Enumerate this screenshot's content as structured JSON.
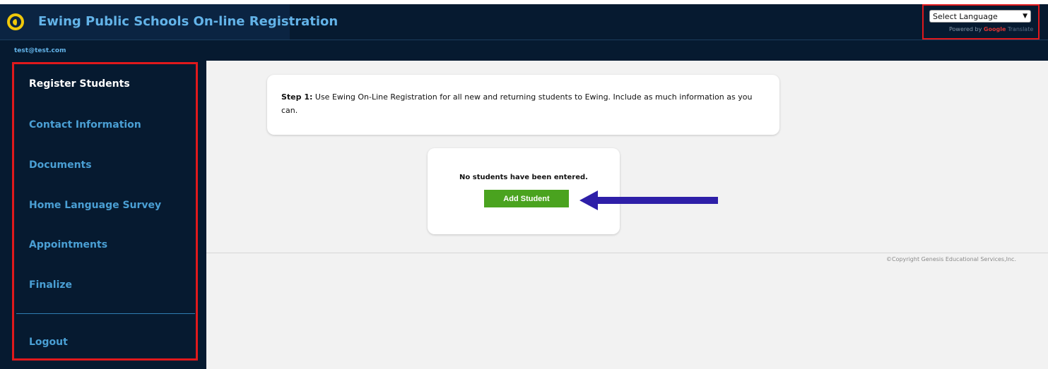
{
  "header": {
    "app_title": "Ewing Public Schools On-line Registration",
    "logo_icon": "genesis-logo-icon",
    "language_select": {
      "selected": "Select Language",
      "powered_prefix": "Powered by",
      "powered_google": "Google",
      "powered_translate": "Translate"
    }
  },
  "user": {
    "email": "test@test.com"
  },
  "sidebar": {
    "items": [
      {
        "label": "Register Students",
        "active": true
      },
      {
        "label": "Contact Information"
      },
      {
        "label": "Documents"
      },
      {
        "label": "Home Language Survey"
      },
      {
        "label": "Appointments"
      },
      {
        "label": "Finalize"
      }
    ],
    "logout_label": "Logout"
  },
  "main": {
    "step": {
      "prefix": "Step 1:",
      "text": " Use Ewing On-Line Registration for all new and returning students to Ewing. Include as much information as you can."
    },
    "students": {
      "empty_message": "No students have been entered.",
      "add_button": "Add Student"
    },
    "copyright": "©Copyright Genesis Educational Services,Inc."
  },
  "colors": {
    "nav_dark": "#061a30",
    "accent_blue": "#63b3e8",
    "highlight_red": "#e0191c",
    "button_green": "#4aa31f",
    "arrow_blue": "#2e1fa8"
  }
}
